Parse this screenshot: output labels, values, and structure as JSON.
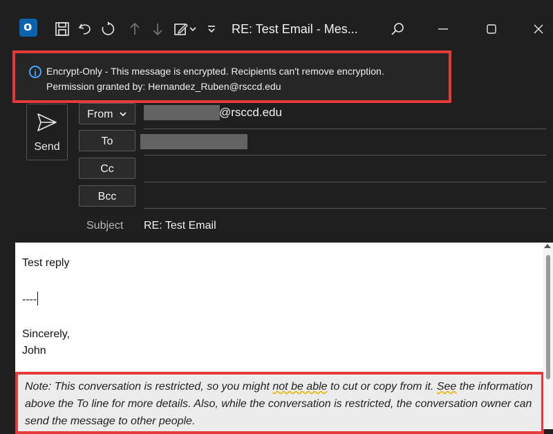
{
  "titlebar": {
    "title": "RE: Test Email  -  Mes...",
    "icons": [
      "outlook-icon",
      "save-icon",
      "undo-icon",
      "redo-icon",
      "up-arrow-icon",
      "down-arrow-icon",
      "edit-icon",
      "more-icon",
      "search-icon",
      "minimize-icon",
      "maximize-icon",
      "close-icon"
    ]
  },
  "infobar": {
    "line1": "Encrypt-Only - This message is encrypted. Recipients can't remove encryption.",
    "line2": "Permission granted by: Hernandez_Ruben@rsccd.edu"
  },
  "header": {
    "send_label": "Send",
    "from_label": "From",
    "from_domain": "@rsccd.edu",
    "to_label": "To",
    "cc_label": "Cc",
    "bcc_label": "Bcc",
    "subject_label": "Subject",
    "subject_value": "RE: Test Email"
  },
  "body": {
    "line1": "Test reply",
    "line2": "----",
    "line3": "Sincerely,",
    "line4": "John"
  },
  "note": {
    "part1": "Note: This conversation is restricted, so you might ",
    "part2": "not be able",
    "part3": " to cut or copy from it. ",
    "part4": "See",
    "part5": " the information above the To line for more details. Also, while the conversation is restricted, the conversation owner can send the message to other people."
  },
  "colors": {
    "highlight_border": "#e63a3a",
    "dark_bg": "#1f1f1f",
    "info_blue": "#4aa3ff"
  }
}
